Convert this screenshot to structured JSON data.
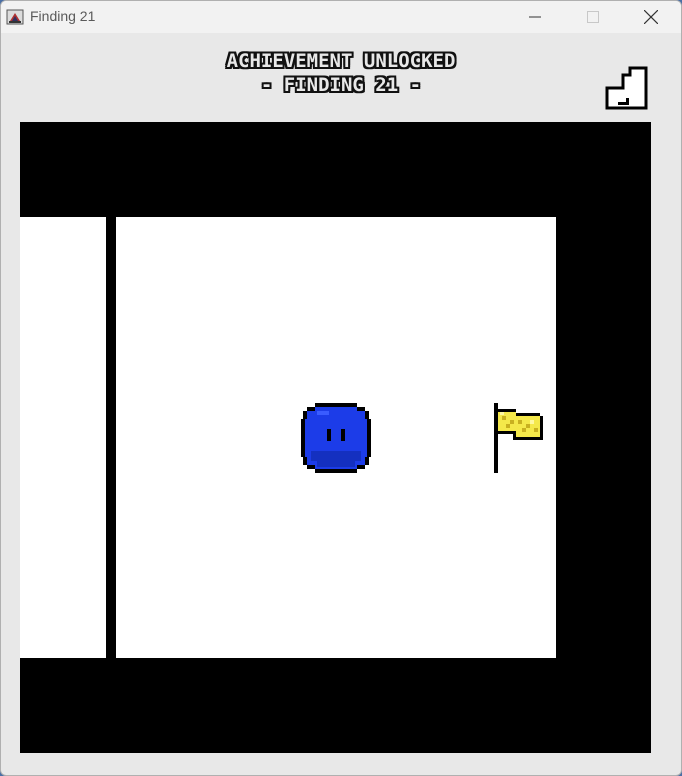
{
  "window": {
    "title": "Finding 21",
    "app_icon": "java-cup-icon",
    "controls": {
      "minimize_icon": "minimize-icon",
      "maximize_icon": "maximize-icon",
      "close_icon": "close-icon"
    }
  },
  "banner": {
    "line1": "ACHIEVEMENT UNLOCKED",
    "line2": "- FINDING 21 -"
  },
  "exit_button": {
    "icon": "exit-door-icon"
  },
  "game": {
    "background_color": "#000000",
    "room_color": "#ffffff",
    "player": {
      "icon": "blue-blob-player-icon",
      "color": "#1a33e6"
    },
    "goal": {
      "icon": "yellow-flag-icon",
      "color": "#f2e640"
    }
  }
}
